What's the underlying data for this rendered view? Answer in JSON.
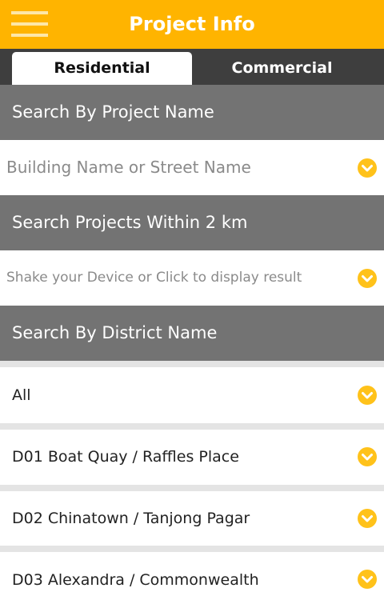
{
  "header": {
    "title": "Project Info",
    "menu_icon": "hamburger-menu-icon"
  },
  "tabs": [
    {
      "label": "Residential",
      "active": true
    },
    {
      "label": "Commercial",
      "active": false
    }
  ],
  "search_project": {
    "heading": "Search By Project Name",
    "placeholder": "Building Name or Street Name"
  },
  "search_nearby": {
    "heading": "Search Projects Within 2 km",
    "placeholder": "Shake your Device or Click to display result"
  },
  "search_district": {
    "heading": "Search By District Name",
    "items": [
      "All",
      "D01 Boat Quay / Raffles Place",
      "D02 Chinatown / Tanjong Pagar",
      "D03 Alexandra / Commonwealth"
    ]
  },
  "colors": {
    "accent": "#ffb400",
    "tabbar": "#3e3e3e",
    "section_header": "#737373",
    "chevron": "#ffc21a"
  },
  "icons": {
    "dropdown": "chevron-down-circle-icon"
  }
}
